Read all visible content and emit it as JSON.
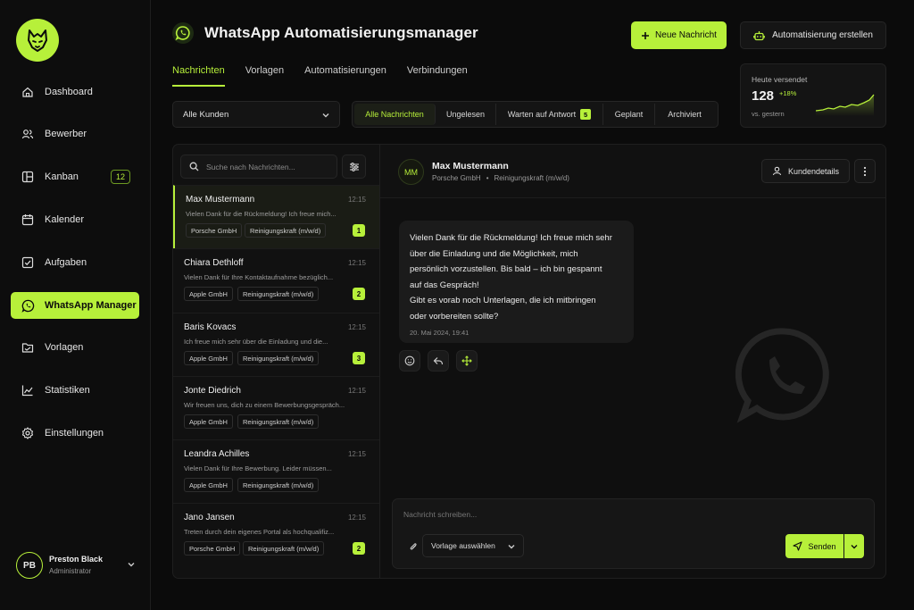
{
  "sidebar": {
    "items": [
      {
        "label": "Dashboard",
        "icon": "home-icon"
      },
      {
        "label": "Bewerber",
        "icon": "users-icon"
      },
      {
        "label": "Kanban",
        "icon": "kanban-icon",
        "badge": "12"
      },
      {
        "label": "Kalender",
        "icon": "calendar-icon"
      },
      {
        "label": "Aufgaben",
        "icon": "checkbox-icon"
      },
      {
        "label": "WhatsApp Manager",
        "icon": "whatsapp-icon",
        "active": true
      },
      {
        "label": "Vorlagen",
        "icon": "folder-icon"
      },
      {
        "label": "Statistiken",
        "icon": "chart-icon"
      },
      {
        "label": "Einstellungen",
        "icon": "gear-icon"
      }
    ],
    "user": {
      "initials": "PB",
      "name": "Preston Black",
      "role": "Administrator"
    }
  },
  "header": {
    "title": "WhatsApp Automatisierungsmanager",
    "primary_button": "Neue Nachricht",
    "secondary_button": "Automatisierung erstellen",
    "tabs": [
      "Nachrichten",
      "Vorlagen",
      "Automatisierungen",
      "Verbindungen"
    ]
  },
  "stats": {
    "label": "Heute versendet",
    "value": "128",
    "change": "+18%",
    "sub": "vs. gestern"
  },
  "filters": {
    "dropdown": "Alle Kunden",
    "segments": [
      "Alle Nachrichten",
      "Ungelesen",
      "Warten auf Antwort",
      "Geplant",
      "Archiviert"
    ],
    "waiting_badge": "5"
  },
  "list": {
    "search_placeholder": "Suche nach Nachrichten...",
    "conversations": [
      {
        "name": "Max Mustermann",
        "time": "12:15",
        "preview": "Vielen Dank für die Rückmeldung! Ich freue mich...",
        "company": "Porsche GmbH",
        "role": "Reinigungskraft (m/w/d)",
        "badge": "1"
      },
      {
        "name": "Chiara Dethloff",
        "time": "12:15",
        "preview": "Vielen Dank für Ihre Kontaktaufnahme bezüglich...",
        "company": "Apple GmbH",
        "role": "Reinigungskraft (m/w/d)",
        "badge": "2"
      },
      {
        "name": "Baris Kovacs",
        "time": "12:15",
        "preview": "Ich freue mich sehr über die Einladung und die...",
        "company": "Apple GmbH",
        "role": "Reinigungskraft (m/w/d)",
        "badge": "3"
      },
      {
        "name": "Jonte Diedrich",
        "time": "12:15",
        "preview": "Wir freuen uns, dich zu einem Bewerbungsgespräch...",
        "company": "Apple GmbH",
        "role": "Reinigungskraft (m/w/d)",
        "badge": ""
      },
      {
        "name": "Leandra Achilles",
        "time": "12:15",
        "preview": "Vielen Dank für Ihre Bewerbung. Leider müssen...",
        "company": "Apple GmbH",
        "role": "Reinigungskraft (m/w/d)",
        "badge": ""
      },
      {
        "name": "Jano Jansen",
        "time": "12:15",
        "preview": "Treten durch dein eigenes Portal als hochqualifiz...",
        "company": "Porsche GmbH",
        "role": "Reinigungskraft (m/w/d)",
        "badge": "2"
      }
    ]
  },
  "chat": {
    "initials": "MM",
    "name": "Max Mustermann",
    "company": "Porsche GmbH",
    "separator": "•",
    "role": "Reinigungskraft (m/w/d)",
    "details_button": "Kundendetails",
    "message_lines": [
      "Vielen Dank für die Rückmeldung! Ich freue mich sehr",
      "über die Einladung und die Möglichkeit, mich",
      "persönlich vorzustellen. Bis bald – ich bin gespannt",
      "auf das Gespräch!",
      "Gibt es vorab noch Unterlagen, die ich mitbringen",
      "oder vorbereiten sollte?"
    ],
    "message_time": "20. Mai 2024, 19:41",
    "composer_placeholder": "Nachricht schreiben...",
    "template_select": "Vorlage auswählen",
    "send_button": "Senden"
  },
  "colors": {
    "accent": "#b7f03a",
    "background": "#0b0b0b",
    "panel": "#111111"
  }
}
